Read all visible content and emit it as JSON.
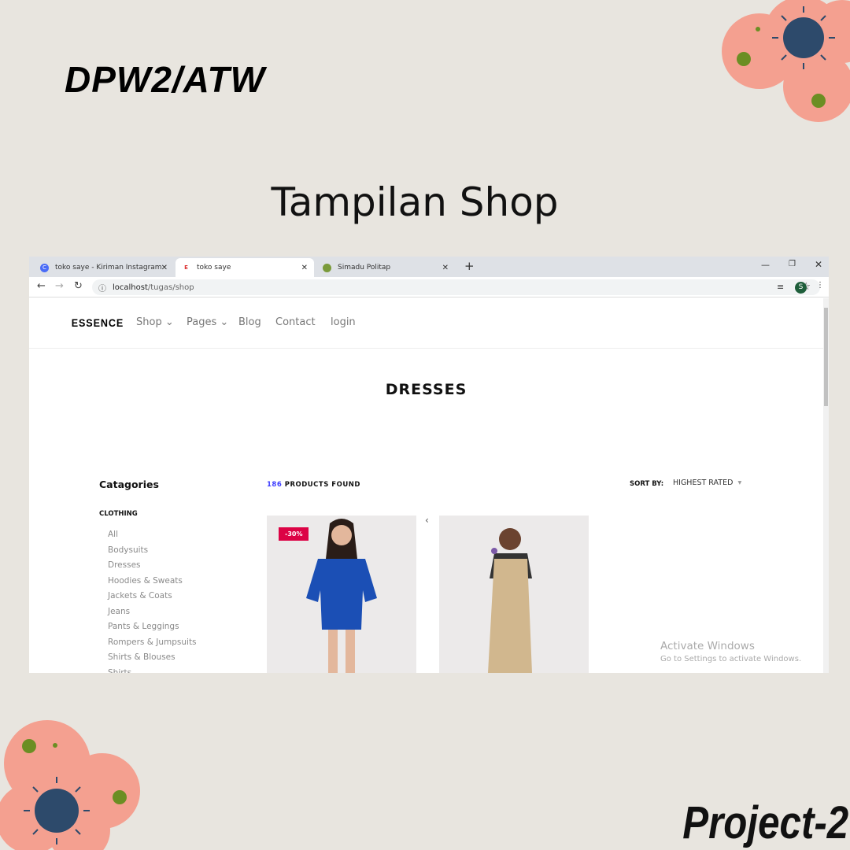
{
  "slide": {
    "header": "DPW2/ATW",
    "title": "Tampilan Shop",
    "footer": "Project-2"
  },
  "browser": {
    "tabs": [
      {
        "label": "toko saye - Kiriman Instagram",
        "icon": "C"
      },
      {
        "label": "toko saye",
        "icon": "E"
      },
      {
        "label": "Simadu Politap"
      }
    ],
    "url_host": "localhost",
    "url_path": "/tugas/shop",
    "profile": "S"
  },
  "site": {
    "logo": "ESSENCE",
    "nav": [
      "Shop",
      "Pages",
      "Blog",
      "Contact",
      "login"
    ],
    "page_title": "DRESSES",
    "sidebar_title": "Catagories",
    "section": "CLOTHING",
    "categories": [
      "All",
      "Bodysuits",
      "Dresses",
      "Hoodies & Sweats",
      "Jackets & Coats",
      "Jeans",
      "Pants & Leggings",
      "Rompers & Jumpsuits",
      "Shirts & Blouses",
      "Shirts"
    ],
    "count": "186",
    "count_label": "PRODUCTS FOUND",
    "sort_label": "SORT BY:",
    "sort_value": "HIGHEST RATED",
    "badge": "-30%",
    "carousel_prev": "‹"
  },
  "watermark": {
    "title": "Activate Windows",
    "sub": "Go to Settings to activate Windows."
  },
  "colors": {
    "bg": "#e8e5df",
    "petal": "#f4a090",
    "center": "#2d4a6b",
    "accent": "#3e3eff",
    "badge": "#dc0345"
  }
}
